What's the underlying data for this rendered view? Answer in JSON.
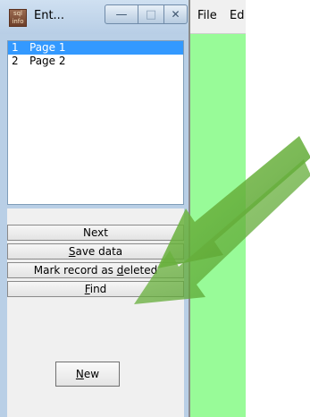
{
  "window": {
    "title": "Ent...",
    "icon_label": "sql\ninfo"
  },
  "titlebar_buttons": {
    "minimize": "—",
    "maximize": "□",
    "close": "✕"
  },
  "page_list": [
    {
      "num": "1",
      "label": "Page 1",
      "selected": true
    },
    {
      "num": "2",
      "label": "Page 2",
      "selected": false
    }
  ],
  "buttons": {
    "next": "Next",
    "save_prefix": "",
    "save_accel": "S",
    "save_rest": "ave data",
    "mark_prefix": "Mark record as ",
    "mark_accel": "d",
    "mark_rest": "eleted",
    "find_accel": "F",
    "find_rest": "ind",
    "new_accel": "N",
    "new_rest": "ew"
  },
  "menu": {
    "file": "File",
    "edit": "Ed"
  },
  "colors": {
    "right_panel": "#98fb98",
    "arrow": "#5aa832",
    "selection": "#3399ff"
  }
}
